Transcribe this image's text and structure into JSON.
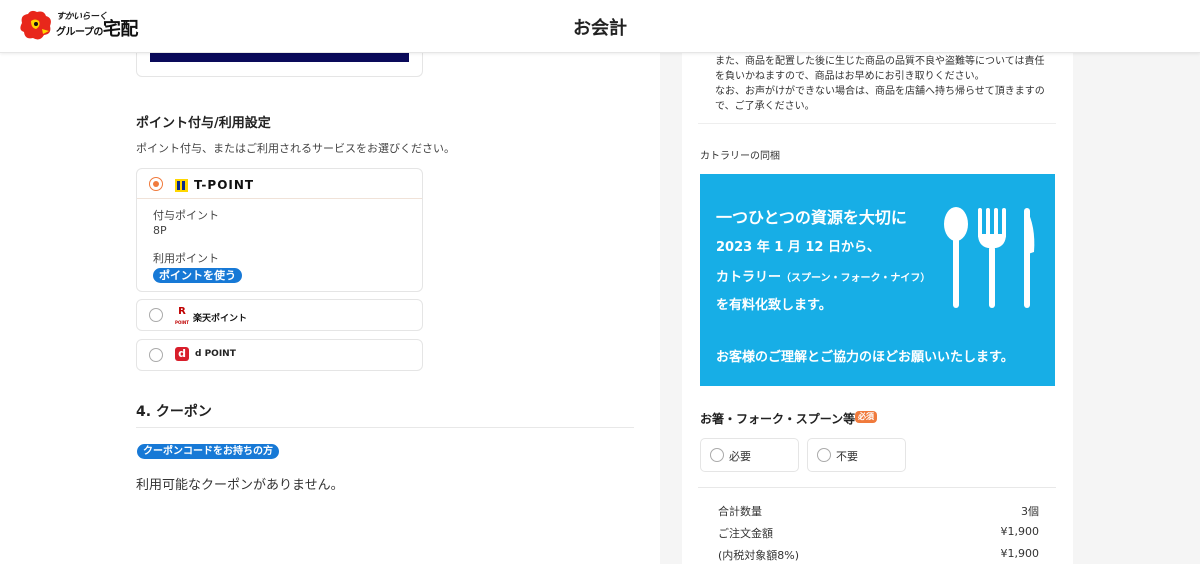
{
  "header": {
    "logo_small": "すかいらーく",
    "logo_big_prefix": "グループの",
    "logo_big": "宅配",
    "title": "お会計"
  },
  "points": {
    "title": "ポイント付与/利用設定",
    "description": "ポイント付与、またはご利用されるサービスをお選びください。",
    "tpoint": {
      "name": "T-POINT",
      "award_label": "付与ポイント",
      "award_value": "8P",
      "use_label": "利用ポイント",
      "use_button": "ポイントを使う",
      "selected": true
    },
    "rakuten": {
      "mark": "R",
      "sub": "POINT",
      "name": "楽天ポイント",
      "selected": false
    },
    "dpoint": {
      "mark": "d",
      "name": "d POINT",
      "selected": false
    }
  },
  "coupon": {
    "title": "4. クーポン",
    "code_button": "クーポンコードをお持ちの方",
    "message": "利用可能なクーポンがありません。"
  },
  "notice": {
    "lines": [
      "また、商品を配置した後に生じた商品の品質不良や盗難等については責任",
      "を負いかねますので、商品はお早めにお引き取りください。",
      "なお、お声がけができない場合は、商品を店舗へ持ち帰らせて頂きますの",
      "で、ご了承ください。"
    ]
  },
  "cutlery": {
    "label": "カトラリーの同梱",
    "banner": {
      "line1": "一つひとつの資源を大切に",
      "line2": "2023 年 1 月 12 日から、",
      "line3_main": "カトラリー",
      "line3_sub": "（スプーン・フォーク・ナイフ）",
      "line4": "を有料化致します。",
      "line5": "お客様のご理解とご協力のほどお願いいたします。"
    },
    "question": "お箸・フォーク・スプーン等",
    "required_badge": "必須",
    "options": [
      "必要",
      "不要"
    ]
  },
  "summary": {
    "rows": [
      {
        "label": "合計数量",
        "value": "3個"
      },
      {
        "label": "ご注文金額",
        "value": "¥1,900"
      },
      {
        "label": "(内税対象額8%)",
        "value": "¥1,900"
      }
    ]
  },
  "colors": {
    "accent_orange": "#f07a3c",
    "button_blue": "#1779d6",
    "banner_blue": "#17aee6",
    "navy": "#0a0a5a"
  }
}
